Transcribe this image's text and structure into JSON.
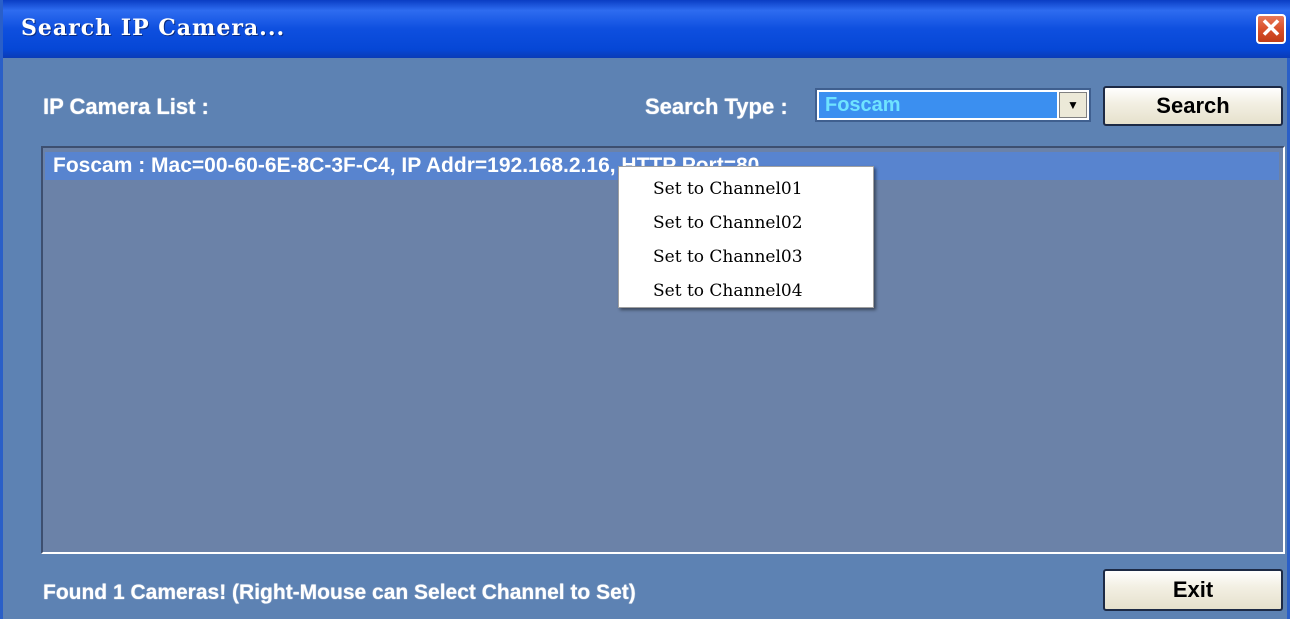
{
  "window": {
    "title": "Search IP Camera...",
    "close_glyph": "✕"
  },
  "toolbar": {
    "list_label": "IP Camera List :",
    "search_type_label": "Search Type :",
    "search_type_value": "Foscam",
    "dropdown_arrow": "▼",
    "search_button": "Search"
  },
  "camera_list": {
    "items": [
      {
        "text": "Foscam : Mac=00-60-6E-8C-3F-C4,  IP Addr=192.168.2.16,  HTTP Port=80"
      }
    ]
  },
  "context_menu": {
    "items": [
      {
        "label": "Set to Channel01"
      },
      {
        "label": "Set to Channel02"
      },
      {
        "label": "Set to Channel03"
      },
      {
        "label": "Set to Channel04"
      }
    ]
  },
  "status": {
    "text": "Found 1 Cameras!  (Right-Mouse can Select Channel to Set)",
    "exit_button": "Exit"
  },
  "colors": {
    "title_bar": "#0e4fdf",
    "dialog_bg": "#5d82b3",
    "list_bg": "#6b82a8",
    "selected_row": "#5884cf",
    "combo_highlight": "#3b8ff0",
    "close_button": "#d9502a"
  }
}
